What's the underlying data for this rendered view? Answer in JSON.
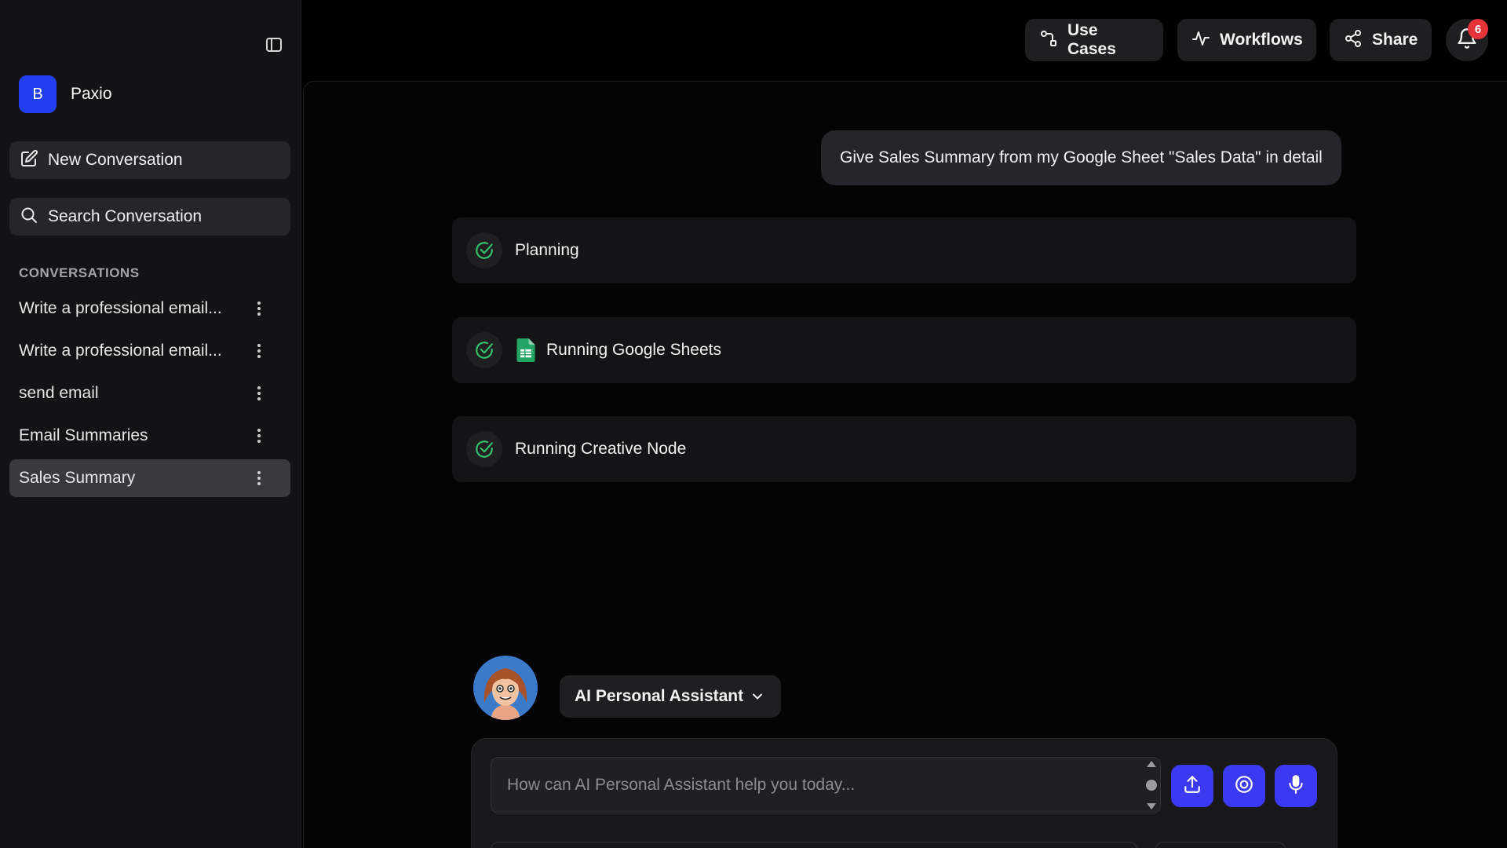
{
  "sidebar": {
    "workspace_initial": "B",
    "workspace_name": "Paxio",
    "new_conversation_label": "New Conversation",
    "search_conversation_label": "Search Conversation",
    "section_title": "CONVERSATIONS",
    "conversations": [
      {
        "label": "Write a professional email..."
      },
      {
        "label": "Write a professional email..."
      },
      {
        "label": "send email"
      },
      {
        "label": "Email Summaries"
      },
      {
        "label": "Sales Summary",
        "active": true
      }
    ]
  },
  "header": {
    "use_cases_label": "Use Cases",
    "workflows_label": "Workflows",
    "share_label": "Share",
    "notification_count": "6"
  },
  "chat": {
    "user_message": "Give Sales Summary from my Google Sheet \"Sales Data\" in detail",
    "steps": [
      {
        "label": "Planning",
        "status": "done",
        "icon": "check-circle-icon"
      },
      {
        "label": "Running Google Sheets",
        "status": "done",
        "icon": "google-sheets-icon"
      },
      {
        "label": "Running Creative Node",
        "status": "done",
        "icon": "check-circle-icon"
      }
    ]
  },
  "composer": {
    "assistant_name": "AI Personal Assistant",
    "placeholder": "How can AI Personal Assistant help you today...",
    "value": ""
  },
  "colors": {
    "accent": "#3b39f2",
    "workspace_avatar": "#1f3ff0",
    "success": "#34c36b",
    "badge": "#e5333a",
    "background": "#000000"
  }
}
